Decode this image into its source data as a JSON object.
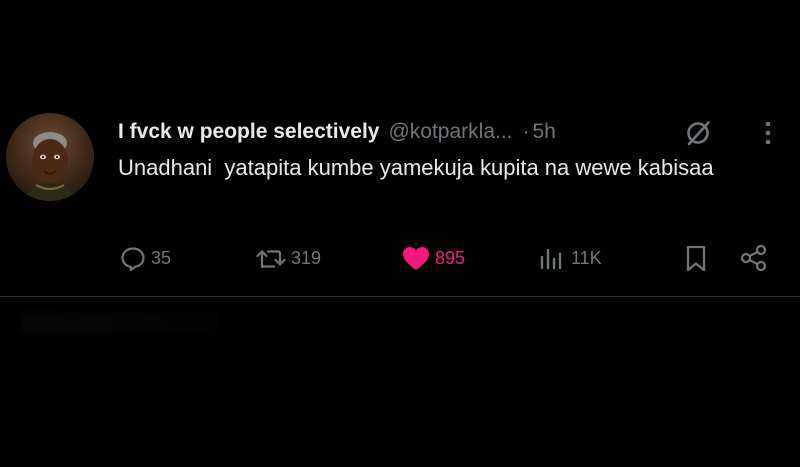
{
  "tweet": {
    "display_name": "I fvck w people selectively",
    "handle": "@kotparkla...",
    "separator": "·",
    "time": "5h",
    "text": "Unadhani  yatapita kumbe yamekuja kupita na wewe kabisaa",
    "avatar_icon": "avatar-photo"
  },
  "actions": {
    "reply": {
      "icon": "reply-icon",
      "count": "35"
    },
    "repost": {
      "icon": "repost-icon",
      "count": "319"
    },
    "like": {
      "icon": "heart-icon",
      "count": "895",
      "color": "#f91880"
    },
    "views": {
      "icon": "views-icon",
      "count": "11K"
    },
    "bookmark": {
      "icon": "bookmark-icon"
    },
    "share": {
      "icon": "share-icon"
    }
  },
  "colors": {
    "background": "#000000",
    "text_primary": "#e7e9ea",
    "text_secondary": "#71767b",
    "like_active": "#f91880",
    "divider": "#2f3336"
  }
}
